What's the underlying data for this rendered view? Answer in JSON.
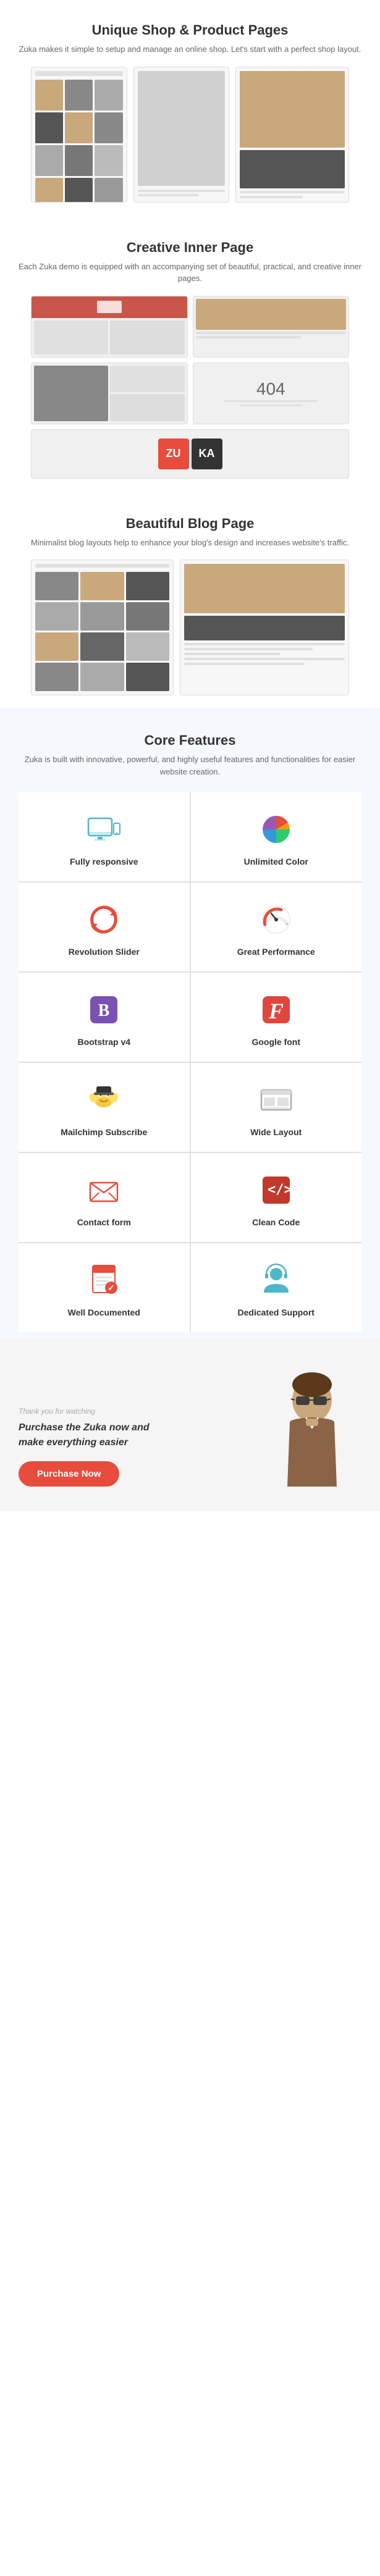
{
  "unique_shop": {
    "title": "Unique Shop & Product Pages",
    "description": "Zuka makes it simple to setup and manage an online shop. Let's start\nwith a perfect shop layout."
  },
  "creative_inner": {
    "title": "Creative Inner Page",
    "description": "Each Zuka demo is equipped with an accompanying set of\nbeautiful, practical, and creative inner pages."
  },
  "beautiful_blog": {
    "title": "Beautiful Blog Page",
    "description": "Minimalist blog layouts help to enhance your blog's design and increases\nwebsite's traffic."
  },
  "core_features": {
    "title": "Core Features",
    "description": "Zuka is built with innovative, powerful, and highly useful features\nand functionalities for easier website creation.",
    "features": [
      {
        "id": "fully-responsive",
        "label": "Fully responsive",
        "icon": "responsive"
      },
      {
        "id": "unlimited-color",
        "label": "Unlimited Color",
        "icon": "color"
      },
      {
        "id": "revolution-slider",
        "label": "Revolution Slider",
        "icon": "revolution"
      },
      {
        "id": "great-performance",
        "label": "Great Performance",
        "icon": "performance"
      },
      {
        "id": "bootstrap-v4",
        "label": "Bootstrap v4",
        "icon": "bootstrap"
      },
      {
        "id": "google-font",
        "label": "Google font",
        "icon": "googlefont"
      },
      {
        "id": "mailchimp-subscribe",
        "label": "Mailchimp Subscribe",
        "icon": "mailchimp"
      },
      {
        "id": "wide-layout",
        "label": "Wide Layout",
        "icon": "widelayout"
      },
      {
        "id": "contact-form",
        "label": "Contact form",
        "icon": "contactform"
      },
      {
        "id": "clean-code",
        "label": "Clean Code",
        "icon": "cleancode"
      },
      {
        "id": "well-documented",
        "label": "Well Documented",
        "icon": "welldoc"
      },
      {
        "id": "dedicated-support",
        "label": "Dedicated Support",
        "icon": "support"
      }
    ]
  },
  "cta": {
    "tagline": "Thank you for watching",
    "main_text_1": "Purchase the ",
    "brand": "Zuka",
    "main_text_2": " now and\nmake everything easier",
    "button_label": "Purchase Now"
  }
}
